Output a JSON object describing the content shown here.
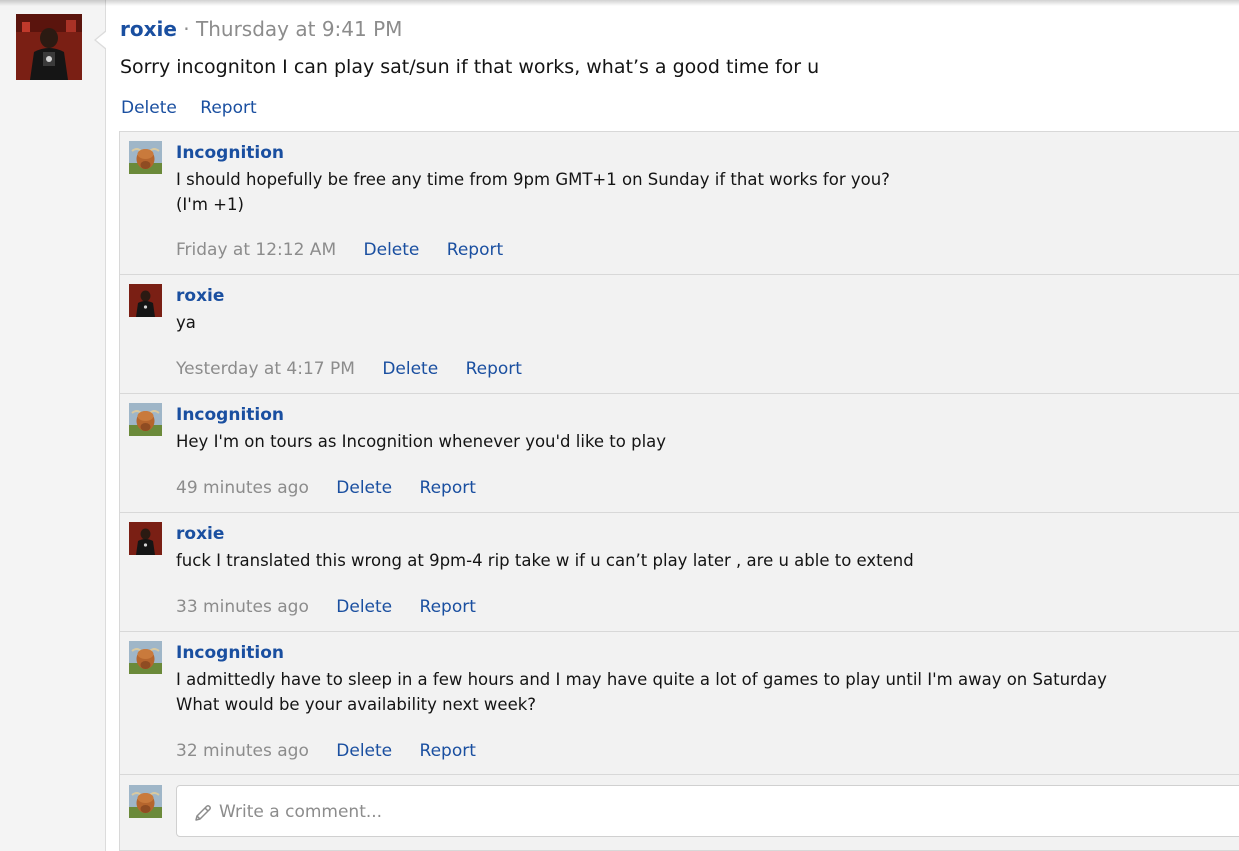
{
  "post": {
    "author": "roxie",
    "separator": "·",
    "time": "Thursday at 9:41 PM",
    "text": "Sorry incogniton I can play sat/sun if that works, what’s a good time for u",
    "actions": {
      "delete": "Delete",
      "report": "Report"
    }
  },
  "comments": [
    {
      "author": "Incognition",
      "avatar": "highland-cow-avatar",
      "lines": [
        "I should hopefully be free any time from 9pm GMT+1 on Sunday if that works for you?",
        "(I'm +1)"
      ],
      "time": "Friday at 12:12 AM",
      "delete": "Delete",
      "report": "Report"
    },
    {
      "author": "roxie",
      "avatar": "roxie-avatar",
      "lines": [
        "ya"
      ],
      "time": "Yesterday at 4:17 PM",
      "delete": "Delete",
      "report": "Report"
    },
    {
      "author": "Incognition",
      "avatar": "highland-cow-avatar",
      "lines": [
        "Hey I'm on tours as Incognition whenever you'd like to play"
      ],
      "time": "49 minutes ago",
      "delete": "Delete",
      "report": "Report"
    },
    {
      "author": "roxie",
      "avatar": "roxie-avatar",
      "lines": [
        "fuck I translated this wrong at 9pm-4 rip take w if u can’t play later , are u able to extend"
      ],
      "time": "33 minutes ago",
      "delete": "Delete",
      "report": "Report"
    },
    {
      "author": "Incognition",
      "avatar": "highland-cow-avatar",
      "lines": [
        "I admittedly have to sleep in a few hours and I may have quite a lot of games to play until I'm away on Saturday",
        "What would be your availability next week?"
      ],
      "time": "32 minutes ago",
      "delete": "Delete",
      "report": "Report"
    }
  ],
  "composer": {
    "icon": "pencil-icon",
    "placeholder": "Write a comment..."
  },
  "colors": {
    "link": "#1a4fa0",
    "muted": "#8c8c8c",
    "panel": "#f2f2f2",
    "border": "#d8d8d8"
  }
}
